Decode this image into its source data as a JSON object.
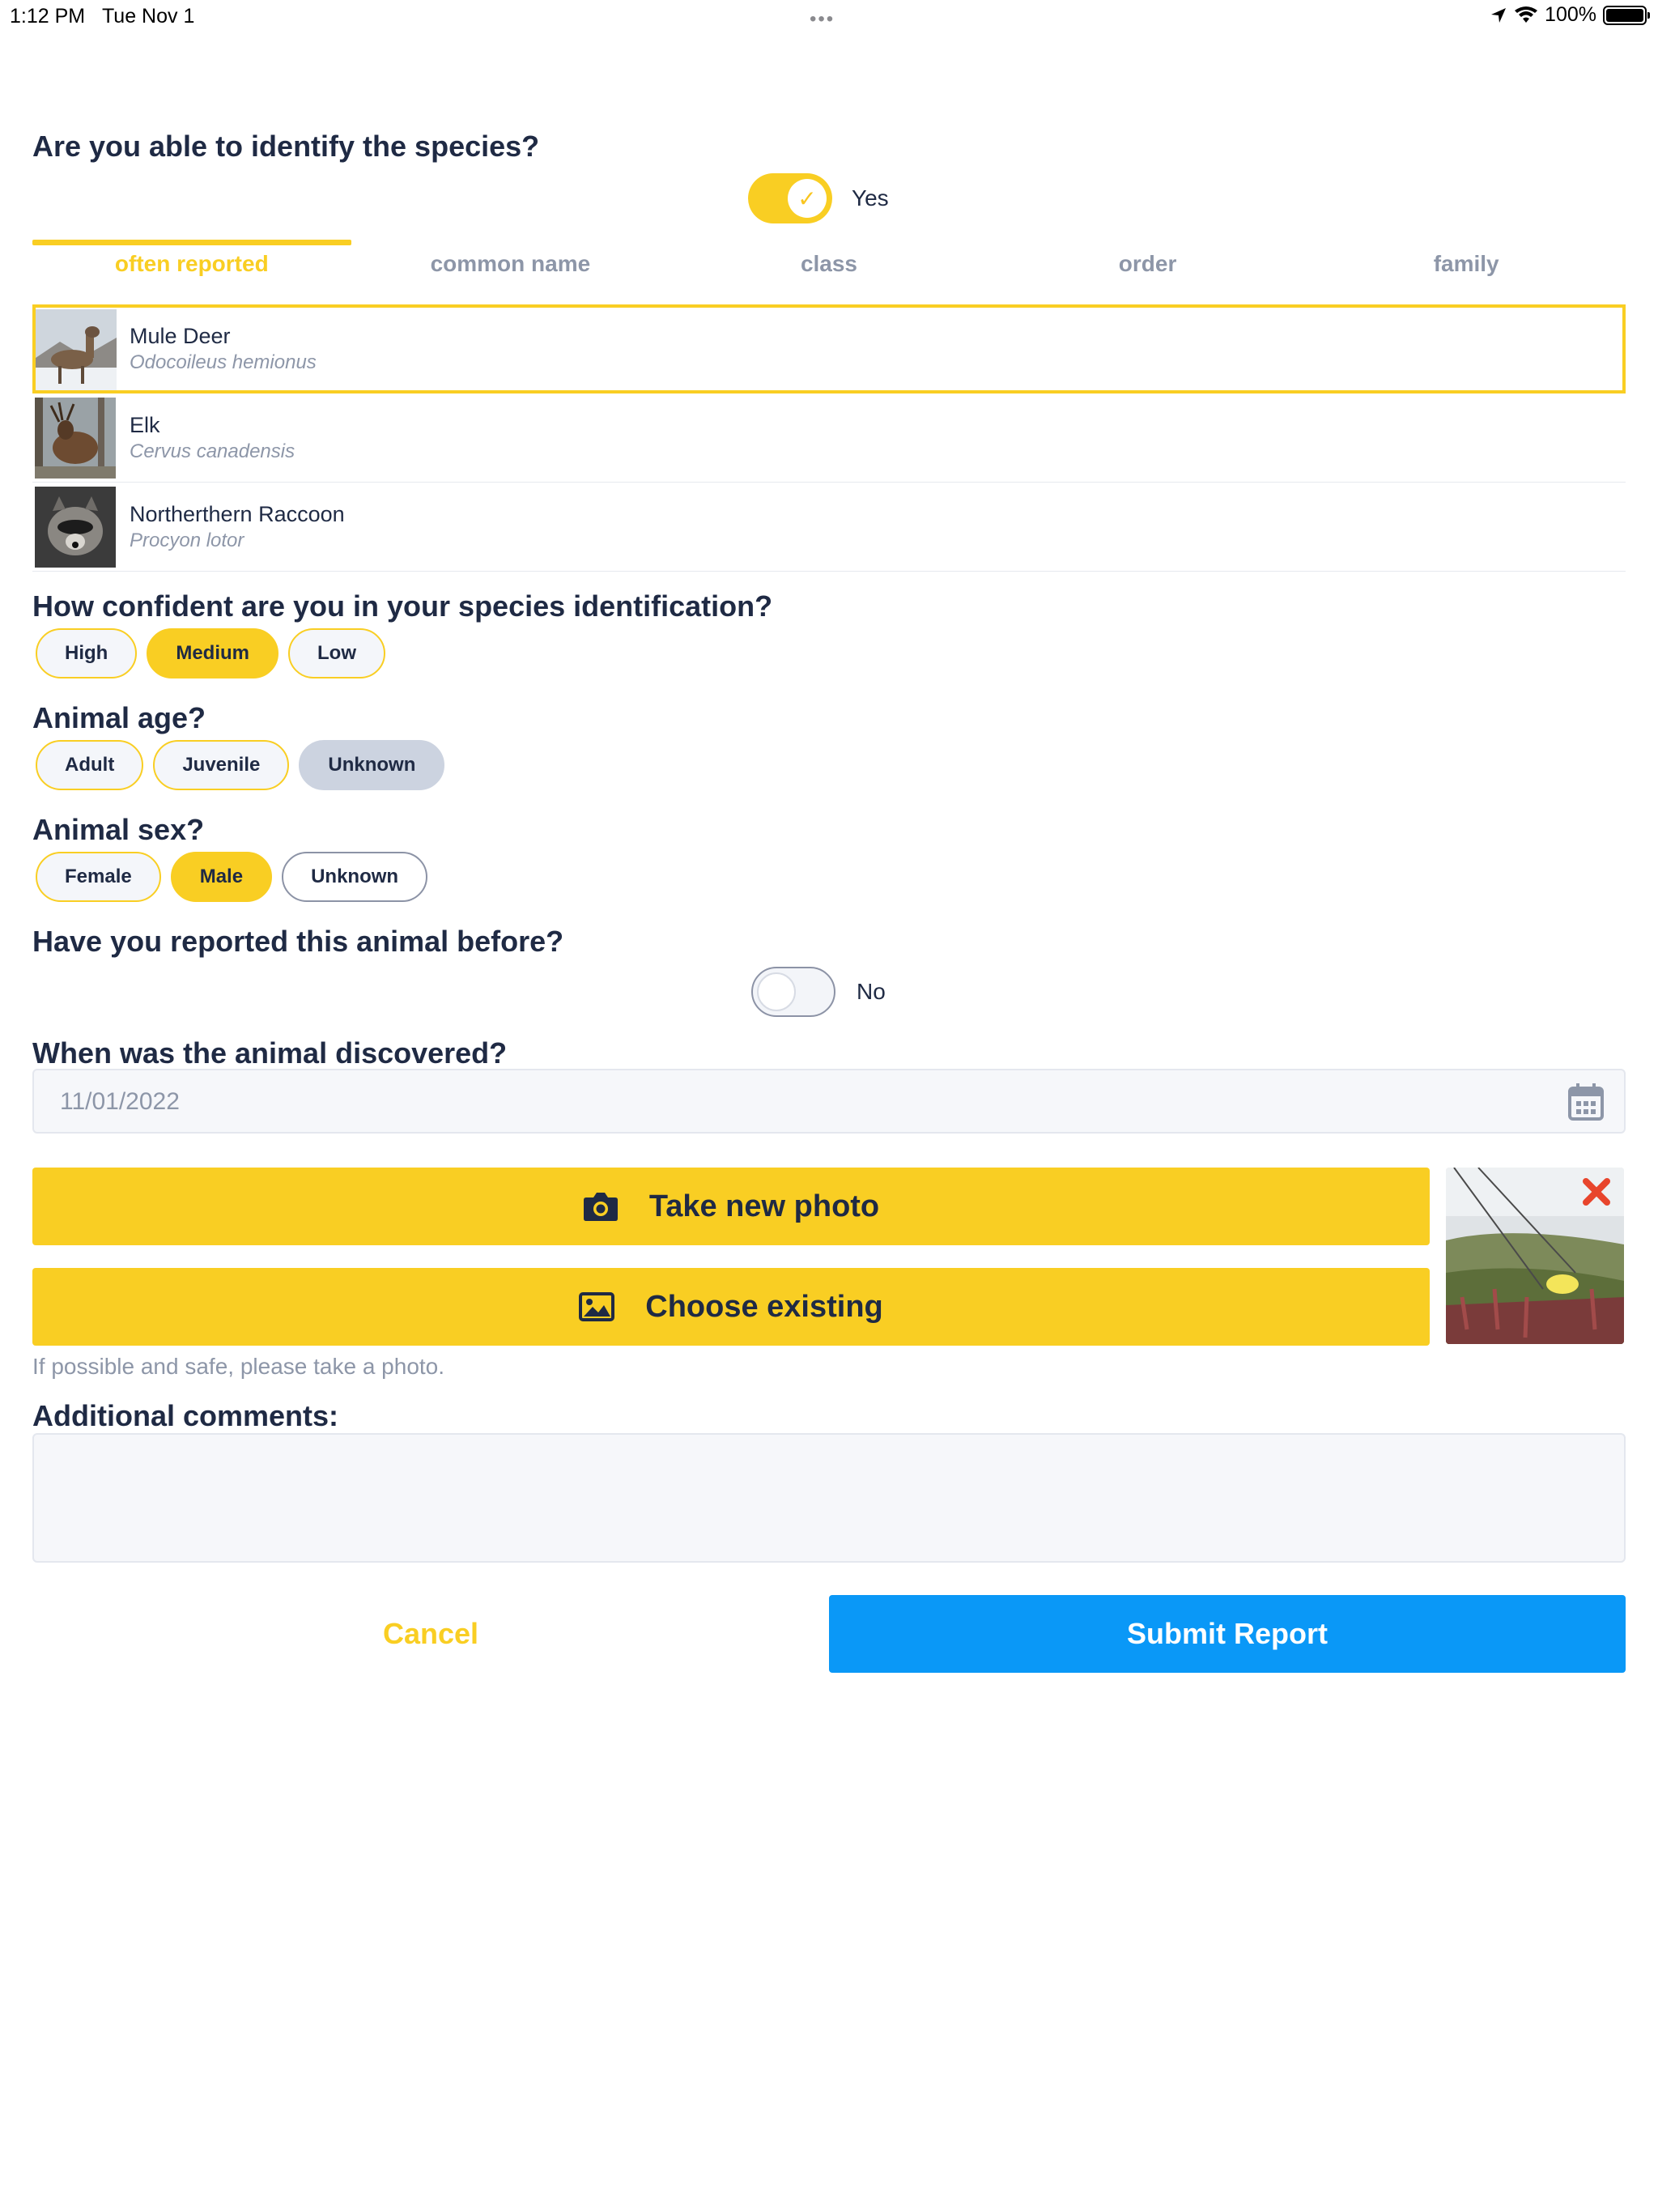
{
  "status_bar": {
    "time": "1:12 PM",
    "date": "Tue Nov 1",
    "battery": "100%",
    "dots": "•••"
  },
  "identify": {
    "question": "Are you able to identify the species?",
    "toggle_on": true,
    "toggle_label": "Yes"
  },
  "tabs": [
    "often reported",
    "common name",
    "class",
    "order",
    "family"
  ],
  "species": [
    {
      "name": "Mule Deer",
      "scientific": "Odocoileus hemionus",
      "selected": true
    },
    {
      "name": "Elk",
      "scientific": "Cervus canadensis",
      "selected": false
    },
    {
      "name": "Northerthern Raccoon",
      "scientific": "Procyon lotor",
      "selected": false
    }
  ],
  "confidence": {
    "question": "How confident are you in your species identification?",
    "options": [
      "High",
      "Medium",
      "Low"
    ],
    "selected": "Medium"
  },
  "age": {
    "question": "Animal age?",
    "options": [
      "Adult",
      "Juvenile",
      "Unknown"
    ],
    "selected": "Unknown"
  },
  "sex": {
    "question": "Animal sex?",
    "options": [
      "Female",
      "Male",
      "Unknown"
    ],
    "selected": "Male"
  },
  "reported_before": {
    "question": "Have you reported this animal before?",
    "toggle_on": false,
    "toggle_label": "No"
  },
  "discovered": {
    "question": "When was the animal discovered?",
    "value": "11/01/2022",
    "icon": "calendar-icon"
  },
  "photo": {
    "take_label": "Take new photo",
    "choose_label": "Choose existing",
    "hint": "If possible and safe, please take a photo."
  },
  "comments": {
    "question": "Additional comments:",
    "value": ""
  },
  "actions": {
    "cancel_label": "Cancel",
    "submit_label": "Submit Report"
  },
  "colors": {
    "accent_yellow": "#f9ce23",
    "submit_blue": "#0a98f7",
    "heading": "#1f2a44",
    "muted": "#8d96a8",
    "remove_red": "#e8452c"
  }
}
